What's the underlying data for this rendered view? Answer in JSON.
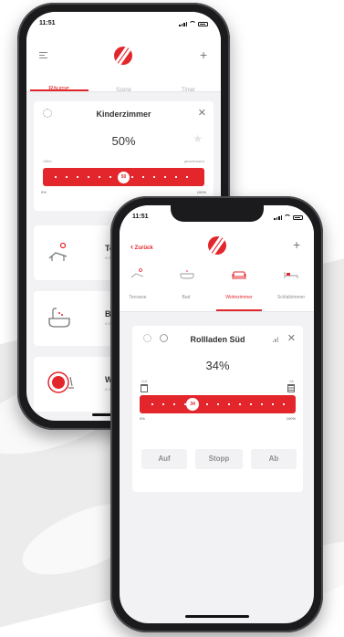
{
  "back_phone": {
    "status_time": "11:51",
    "tabs": [
      {
        "label": "Räume"
      },
      {
        "label": "Szene"
      },
      {
        "label": "Timer"
      }
    ],
    "card": {
      "title": "Kinderzimmer",
      "percent": "50%",
      "label_left": "Offen",
      "label_right": "geschlossen",
      "knob_value": "50",
      "scale_min": "0%",
      "scale_max": "100%",
      "slider_level": 0.5
    },
    "rooms": [
      {
        "name": "Terr",
        "sub": "0 Ger"
      },
      {
        "name": "Bad",
        "sub": "0 Ger"
      },
      {
        "name": "Woh",
        "sub": "0 Ger"
      }
    ]
  },
  "front_phone": {
    "status_time": "11:51",
    "back_label": "Zurück",
    "room_tabs": [
      {
        "label": "Terrasse"
      },
      {
        "label": "Bad"
      },
      {
        "label": "Wohnzimmer"
      },
      {
        "label": "Schlafzimmer"
      }
    ],
    "card": {
      "title": "Rollladen Süd",
      "percent": "34%",
      "label_left": "Auf",
      "label_right": "Ab",
      "knob_value": "34",
      "scale_min": "0%",
      "scale_max": "100%",
      "slider_level": 0.34
    },
    "buttons": {
      "up": "Auf",
      "stop": "Stopp",
      "down": "Ab"
    }
  },
  "colors": {
    "accent": "#e3262b",
    "muted": "#9a9a9e",
    "screen_bg": "#f2f2f4"
  }
}
